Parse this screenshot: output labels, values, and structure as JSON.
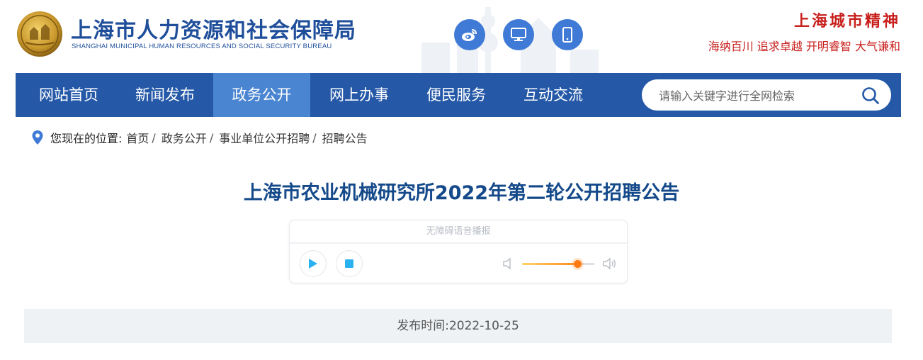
{
  "header": {
    "org_name": "上海市人力资源和社会保障局",
    "org_name_en": "SHANGHAI MUNICIPAL HUMAN RESOURCES AND SOCIAL SECURITY BUREAU",
    "emblem_icon": "shanghai-emblem-icon",
    "social": [
      {
        "icon": "weibo-icon"
      },
      {
        "icon": "desktop-icon"
      },
      {
        "icon": "mobile-icon"
      }
    ],
    "spirit_title": "上海城市精神",
    "spirit_motto": "海纳百川  追求卓越  开明睿智  大气谦和"
  },
  "nav": {
    "items": [
      {
        "label": "网站首页"
      },
      {
        "label": "新闻发布"
      },
      {
        "label": "政务公开"
      },
      {
        "label": "网上办事"
      },
      {
        "label": "便民服务"
      },
      {
        "label": "互动交流"
      }
    ],
    "active_index": 2,
    "search_placeholder": "请输入关键字进行全网检索"
  },
  "breadcrumb": {
    "lead": "您现在的位置:",
    "items": [
      "首页",
      "政务公开",
      "事业单位公开招聘",
      "招聘公告"
    ]
  },
  "article": {
    "title": "上海市农业机械研究所2022年第二轮公开招聘公告",
    "publish_label": "发布时间:",
    "publish_date": "2022-10-25",
    "publish_text": "发布时间:2022-10-25"
  },
  "player": {
    "title": "无障碍语音播报",
    "volume": 0.77
  },
  "colors": {
    "nav_bg": "#2559a8",
    "nav_active": "#4a85d1",
    "brand_blue": "#1f4e9b",
    "title_blue": "#14498a",
    "spirit_red": "#c8201d",
    "volume_accent": "#ff7a12"
  }
}
